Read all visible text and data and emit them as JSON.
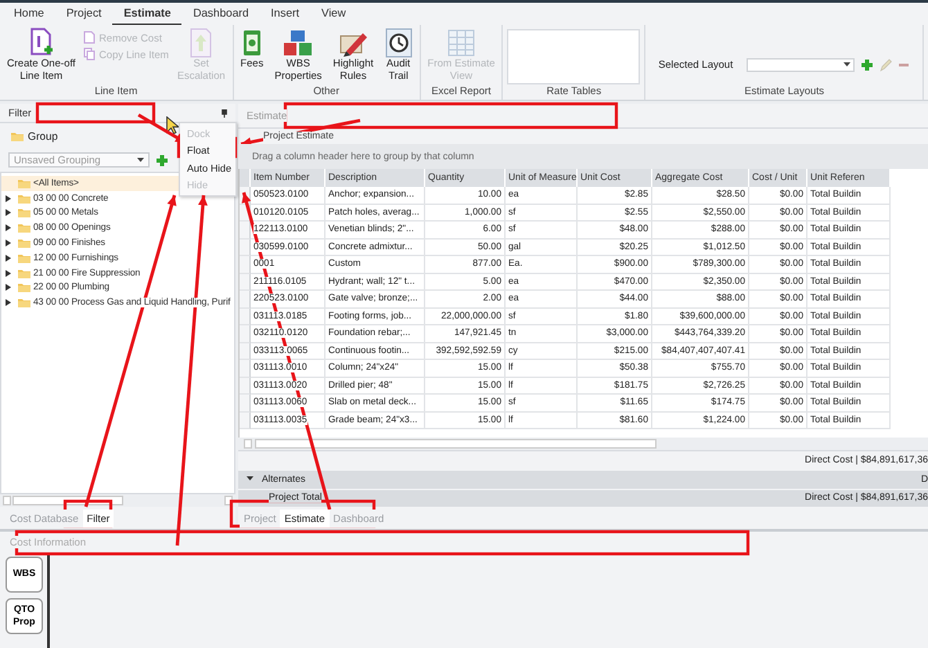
{
  "menu_tabs": [
    {
      "label": "Home",
      "selected": false
    },
    {
      "label": "Project",
      "selected": false
    },
    {
      "label": "Estimate",
      "selected": true
    },
    {
      "label": "Dashboard",
      "selected": false
    },
    {
      "label": "Insert",
      "selected": false
    },
    {
      "label": "View",
      "selected": false
    }
  ],
  "ribbon": {
    "groups": [
      {
        "label": "Line Item",
        "items": [
          {
            "kind": "large",
            "label": [
              "Create One-off",
              "Line Item"
            ],
            "disabled": false
          },
          {
            "kind": "small",
            "label": [
              "Remove Cost"
            ],
            "disabled": true
          },
          {
            "kind": "small",
            "label": [
              "Copy Line Item"
            ],
            "disabled": true
          },
          {
            "kind": "large",
            "label": [
              "Set",
              "Escalation"
            ],
            "disabled": true
          }
        ]
      },
      {
        "label": "Other",
        "items": [
          {
            "kind": "large",
            "label": [
              "Fees"
            ],
            "disabled": false
          },
          {
            "kind": "large",
            "label": [
              "WBS",
              "Properties"
            ],
            "disabled": false
          },
          {
            "kind": "large",
            "label": [
              "Highlight",
              "Rules"
            ],
            "disabled": false
          },
          {
            "kind": "large",
            "label": [
              "Audit",
              "Trail"
            ],
            "disabled": false
          }
        ]
      },
      {
        "label": "Excel Report",
        "items": [
          {
            "kind": "large",
            "label": [
              "From Estimate",
              "View"
            ],
            "disabled": true
          }
        ]
      },
      {
        "label": "Rate Tables",
        "items": [
          {
            "kind": "panel"
          }
        ]
      },
      {
        "label": "Estimate Layouts",
        "items": [
          {
            "kind": "dropdown",
            "label": [
              "Selected Layout"
            ]
          },
          {
            "kind": "icon",
            "disabled": false
          },
          {
            "kind": "icon",
            "disabled": true
          },
          {
            "kind": "icon",
            "disabled": true
          }
        ]
      }
    ]
  },
  "filter_panel": {
    "title": "Filter",
    "group_label": "Group",
    "grouping": {
      "value": "Unsaved Grouping"
    },
    "tree": [
      {
        "label": "<All Items>",
        "selected": true,
        "expandable": false
      },
      {
        "label": "03 00 00 Concrete",
        "selected": false,
        "expandable": true
      },
      {
        "label": "05 00 00 Metals",
        "selected": false,
        "expandable": true
      },
      {
        "label": "08 00 00 Openings",
        "selected": false,
        "expandable": true
      },
      {
        "label": "09 00 00 Finishes",
        "selected": false,
        "expandable": true
      },
      {
        "label": "12 00 00 Furnishings",
        "selected": false,
        "expandable": true
      },
      {
        "label": "21 00 00 Fire Suppression",
        "selected": false,
        "expandable": true
      },
      {
        "label": "22 00 00 Plumbing",
        "selected": false,
        "expandable": true
      },
      {
        "label": "43 00 00 Process Gas and Liquid Handling, Purif",
        "selected": false,
        "expandable": true
      }
    ],
    "tabs": [
      {
        "label": "Cost Database",
        "selected": false
      },
      {
        "label": "Filter",
        "selected": true
      }
    ]
  },
  "context_menu": {
    "items": [
      {
        "label": "Dock",
        "disabled": true
      },
      {
        "label": "Float",
        "disabled": false
      },
      {
        "label": "Auto Hide",
        "disabled": false
      },
      {
        "label": "Hide",
        "disabled": true
      }
    ]
  },
  "estimate_panel": {
    "title": "Estimate",
    "subtitle": "Project Estimate",
    "group_hint": "Drag a column header here to group by that column",
    "table": {
      "columns": [
        "Item Number",
        "Description",
        "Quantity",
        "Unit of Measure",
        "Unit Cost",
        "Aggregate Cost",
        "Cost / Unit",
        "Unit Referen"
      ],
      "rows": [
        [
          "050523.0100",
          "Anchor; expansion...",
          "10.00",
          "ea",
          "$2.85",
          "$28.50",
          "$0.00",
          "Total Buildin"
        ],
        [
          "010120.0105",
          "Patch holes, averag...",
          "1,000.00",
          "sf",
          "$2.55",
          "$2,550.00",
          "$0.00",
          "Total Buildin"
        ],
        [
          "122113.0100",
          "Venetian blinds; 2\"...",
          "6.00",
          "sf",
          "$48.00",
          "$288.00",
          "$0.00",
          "Total Buildin"
        ],
        [
          "030599.0100",
          "Concrete admixtur...",
          "50.00",
          "gal",
          "$20.25",
          "$1,012.50",
          "$0.00",
          "Total Buildin"
        ],
        [
          "0001",
          "Custom",
          "877.00",
          "Ea.",
          "$900.00",
          "$789,300.00",
          "$0.00",
          "Total Buildin"
        ],
        [
          "211116.0105",
          "Hydrant; wall; 12\" t...",
          "5.00",
          "ea",
          "$470.00",
          "$2,350.00",
          "$0.00",
          "Total Buildin"
        ],
        [
          "220523.0100",
          "Gate valve; bronze;...",
          "2.00",
          "ea",
          "$44.00",
          "$88.00",
          "$0.00",
          "Total Buildin"
        ],
        [
          "031113.0185",
          "Footing forms, job...",
          "22,000,000.00",
          "sf",
          "$1.80",
          "$39,600,000.00",
          "$0.00",
          "Total Buildin"
        ],
        [
          "032110.0120",
          "Foundation rebar;...",
          "147,921.45",
          "tn",
          "$3,000.00",
          "$443,764,339.20",
          "$0.00",
          "Total Buildin"
        ],
        [
          "033113.0065",
          "Continuous footin...",
          "392,592,592.59",
          "cy",
          "$215.00",
          "$84,407,407,407.41",
          "$0.00",
          "Total Buildin"
        ],
        [
          "031113.0010",
          "Column; 24\"x24\"",
          "15.00",
          "lf",
          "$50.38",
          "$755.70",
          "$0.00",
          "Total Buildin"
        ],
        [
          "031113.0020",
          "Drilled pier; 48\"",
          "15.00",
          "lf",
          "$181.75",
          "$2,726.25",
          "$0.00",
          "Total Buildin"
        ],
        [
          "031113.0060",
          "Slab on metal deck...",
          "15.00",
          "sf",
          "$11.65",
          "$174.75",
          "$0.00",
          "Total Buildin"
        ],
        [
          "031113.0035",
          "Grade beam; 24\"x3...",
          "15.00",
          "lf",
          "$81.60",
          "$1,224.00",
          "$0.00",
          "Total Buildin"
        ]
      ]
    },
    "direct_cost": "Direct Cost | $84,891,617,36",
    "sections": [
      {
        "kind": "expander",
        "label": "Alternates",
        "value": "D"
      },
      {
        "kind": "total",
        "label": "Project Total",
        "value": "Direct Cost | $84,891,617,36"
      }
    ],
    "tabs": [
      {
        "label": "Project",
        "selected": false
      },
      {
        "label": "Estimate",
        "selected": true
      },
      {
        "label": "Dashboard",
        "selected": false
      }
    ]
  },
  "cost_info": {
    "title": "Cost Information",
    "buttons": [
      [
        "WBS"
      ],
      [
        "QTO",
        "Prop"
      ]
    ]
  }
}
